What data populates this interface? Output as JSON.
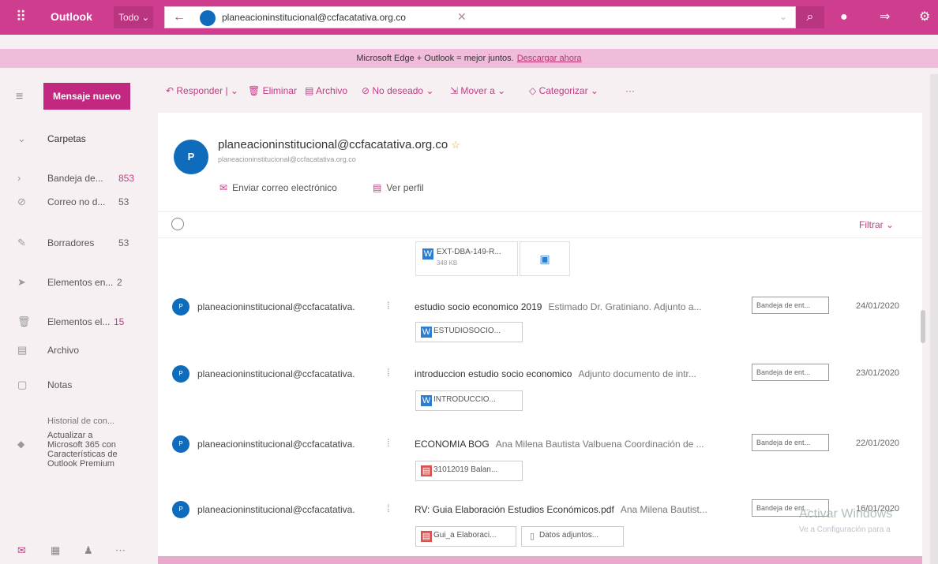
{
  "header": {
    "app_name": "Outlook",
    "scope": "Todo",
    "search_value": "planeacioninstitucional@ccfacatativa.org.co"
  },
  "banner": {
    "text": "Microsoft Edge + Outlook = mejor juntos.",
    "link": "Descargar ahora"
  },
  "nav": {
    "new_message": "Mensaje nuevo",
    "folders_header": "Carpetas",
    "folders": [
      {
        "label": "Bandeja de...",
        "count": "853",
        "icon": "chevron-right-icon"
      },
      {
        "label": "Correo no d...",
        "count": "53",
        "icon": "blocked-icon"
      },
      {
        "label": "Borradores",
        "count": "53",
        "icon": "pencil-icon"
      },
      {
        "label": "Elementos en...",
        "count": "2",
        "icon": "send-icon"
      },
      {
        "label": "Elementos el...",
        "count": "15",
        "icon": "trash-icon"
      },
      {
        "label": "Archivo",
        "count": "",
        "icon": "archive-icon"
      },
      {
        "label": "Notas",
        "count": "",
        "icon": "note-icon"
      }
    ],
    "history_partial": "Historial de con...",
    "upgrade_text": "Actualizar a Microsoft 365 con Características de Outlook Premium"
  },
  "toolbar": {
    "reply": "Responder",
    "delete": "Eliminar",
    "archive": "Archivo",
    "junk": "No deseado",
    "move": "Mover a",
    "categorize": "Categorizar",
    "more": "···"
  },
  "contact": {
    "initial": "P",
    "name": "planeacioninstitucional@ccfacatativa.org.co",
    "email": "planeacioninstitucional@ccfacatativa.org.co",
    "send_email": "Enviar correo electrónico",
    "view_profile": "Ver perfil"
  },
  "filter_label": "Filtrar",
  "top_attachment": {
    "name": "EXT-DBA-149-R...",
    "size": "348 KB"
  },
  "messages": [
    {
      "sender": "planeacioninstitucional@ccfacatativa.",
      "subject": "estudio socio economico 2019",
      "preview": "Estimado Dr. Gratiniano. Adjunto a...",
      "folder": "Bandeja de ent...",
      "date": "24/01/2020",
      "attachments": [
        "ESTUDIOSOCIO..."
      ]
    },
    {
      "sender": "planeacioninstitucional@ccfacatativa.",
      "subject": "introduccion estudio socio economico",
      "preview": "Adjunto documento de intr...",
      "folder": "Bandeja de ent...",
      "date": "23/01/2020",
      "attachments": [
        "INTRODUCCIO..."
      ]
    },
    {
      "sender": "planeacioninstitucional@ccfacatativa.",
      "subject": "ECONOMIA BOG",
      "preview": "Ana Milena Bautista Valbuena Coordinación de ...",
      "folder": "Bandeja de ent...",
      "date": "22/01/2020",
      "attachments": [
        "31012019 Balan..."
      ]
    },
    {
      "sender": "planeacioninstitucional@ccfacatativa.",
      "subject": "RV: Guia Elaboración Estudios Económicos.pdf",
      "preview": "Ana Milena Bautist...",
      "folder": "Bandeja de ent...",
      "date": "16/01/2020",
      "attachments": [
        "Gui_a Elaboraci...",
        "Datos adjuntos..."
      ]
    }
  ],
  "watermark": {
    "line1": "Activar Windows",
    "line2": "Ve a Configuración para a"
  },
  "colors": {
    "brand": "#cf3d8f",
    "accent": "#c2287f",
    "avatar": "#0f6cbd"
  }
}
